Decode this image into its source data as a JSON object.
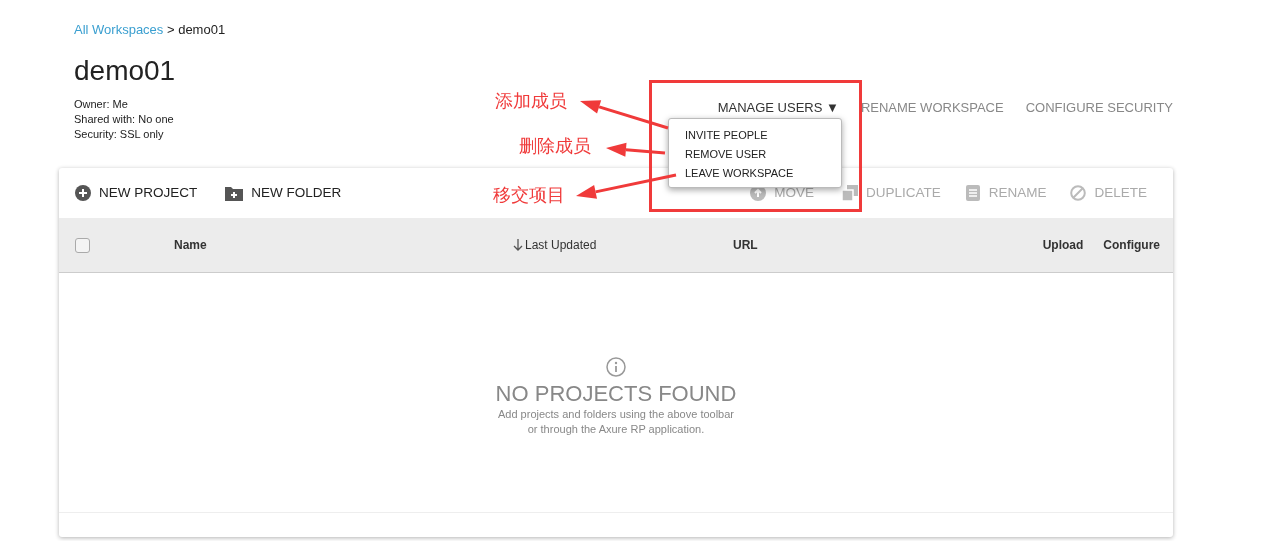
{
  "breadcrumb": {
    "link": "All Workspaces",
    "separator": ">",
    "current": "demo01"
  },
  "title": "demo01",
  "details": [
    "Owner: Me",
    "Shared with: No one",
    "Security: SSL only"
  ],
  "workspace_actions": [
    {
      "label": "MANAGE USERS",
      "kind": "dropdown",
      "expanded": true,
      "caret": "▼"
    },
    {
      "label": "RENAME WORKSPACE",
      "kind": "link"
    },
    {
      "label": "CONFIGURE SECURITY",
      "kind": "link"
    }
  ],
  "manage_users_menu": [
    "INVITE PEOPLE",
    "REMOVE USER",
    "LEAVE WORKSPACE"
  ],
  "toolbar": [
    {
      "label": "NEW PROJECT",
      "disabled": false
    },
    {
      "label": "NEW FOLDER",
      "disabled": false
    },
    {
      "label": "MOVE",
      "disabled": true
    },
    {
      "label": "DUPLICATE",
      "disabled": true
    },
    {
      "label": "RENAME",
      "disabled": true
    },
    {
      "label": "DELETE",
      "disabled": true
    }
  ],
  "table": {
    "select_all": {
      "checked": false
    },
    "columns": [
      {
        "label": "Name",
        "sorted": false
      },
      {
        "label": "Last Updated",
        "sorted": true
      },
      {
        "label": "URL",
        "sorted": false
      },
      {
        "label": "Upload",
        "sorted": false
      },
      {
        "label": "Configure",
        "sorted": false
      }
    ]
  },
  "empty_state": {
    "title": "NO PROJECTS FOUND",
    "lines": [
      "Add projects and folders using the above toolbar",
      "or through the Axure RP application."
    ]
  },
  "annotations": [
    {
      "text": "添加成员"
    },
    {
      "text": "删除成员"
    },
    {
      "text": "移交项目"
    }
  ]
}
